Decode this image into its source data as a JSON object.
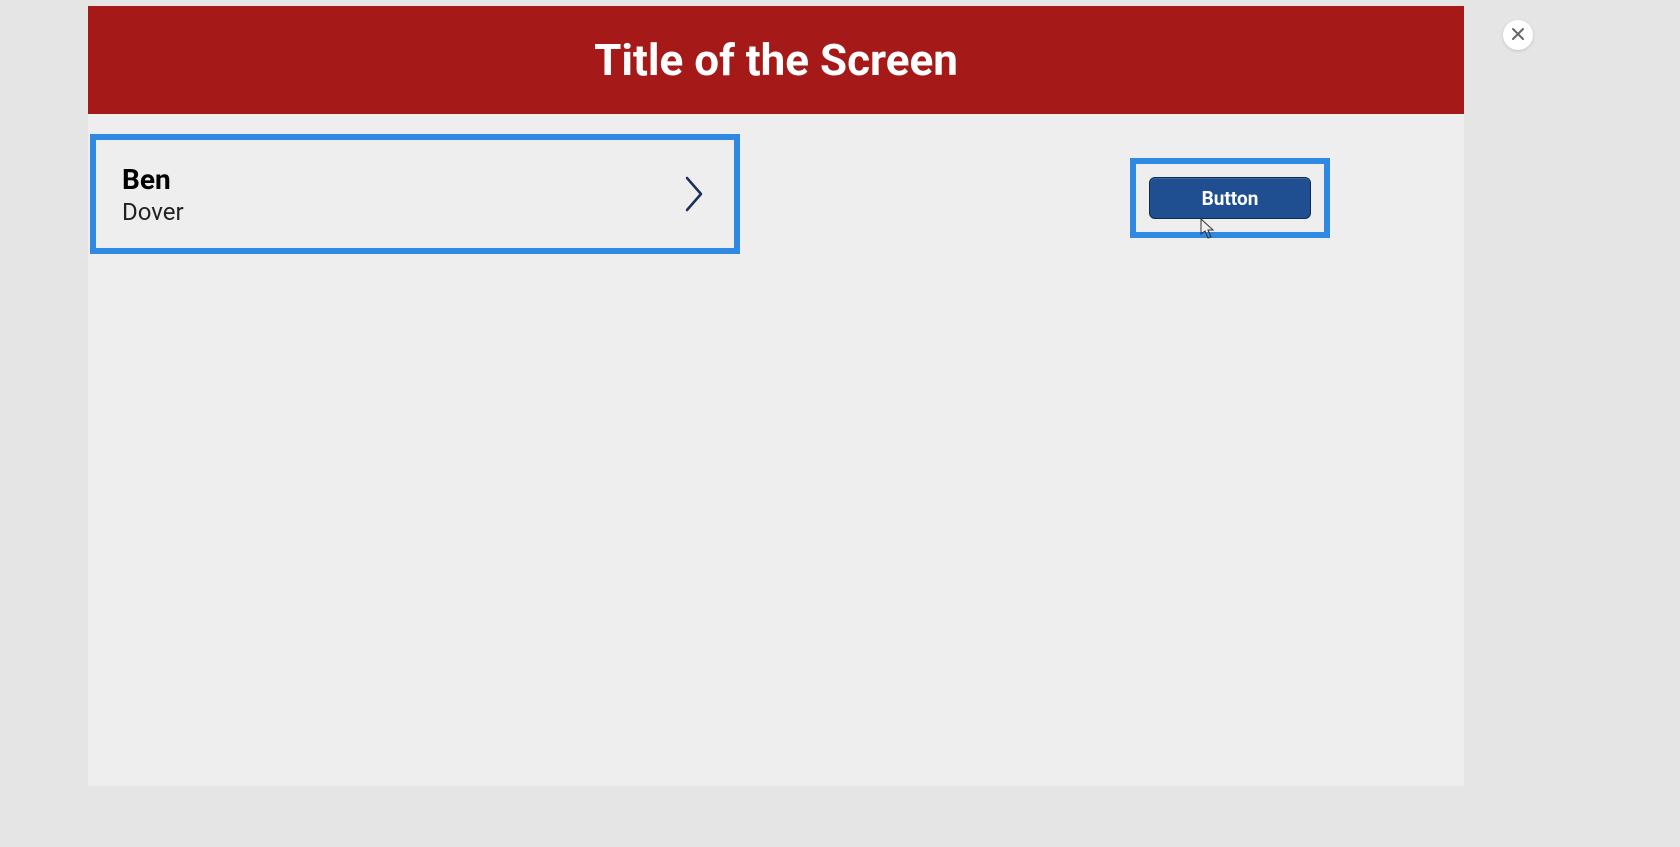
{
  "header": {
    "title": "Title of the Screen"
  },
  "list": {
    "items": [
      {
        "primary": "Ben",
        "secondary": "Dover"
      }
    ]
  },
  "actions": {
    "button_label": "Button"
  }
}
